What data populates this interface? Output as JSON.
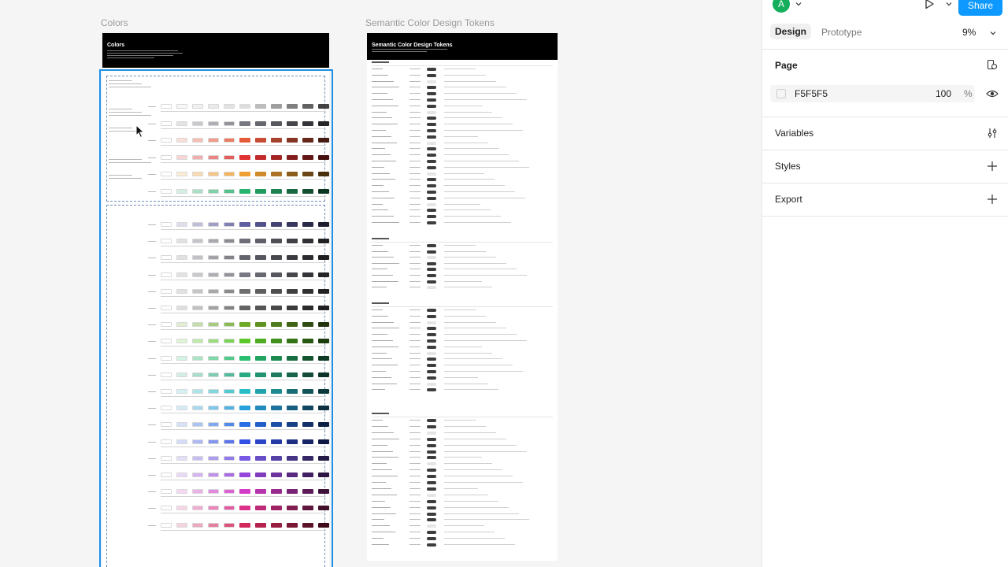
{
  "canvas": {
    "frames": [
      {
        "label": "Colors",
        "header_title": "Colors"
      },
      {
        "label": "Semantic Color Design Tokens",
        "header_title": "Semantic Color Design Tokens"
      }
    ]
  },
  "toolbar": {
    "avatar_initial": "A",
    "share_label": "Share"
  },
  "tabs": {
    "design": "Design",
    "prototype": "Prototype",
    "zoom": "9%"
  },
  "page_section": {
    "title": "Page",
    "fill_hex": "F5F5F5",
    "opacity": "100",
    "opacity_unit": "%"
  },
  "sections": {
    "variables": "Variables",
    "styles": "Styles",
    "export": "Export"
  },
  "colors": {
    "accent": "#0d99ff",
    "selection": "#1f8fe5",
    "avatar": "#14ae5c"
  }
}
